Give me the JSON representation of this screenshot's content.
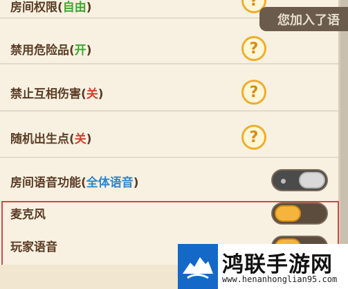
{
  "settings": {
    "room_permission": {
      "label": "房间权限",
      "value": "自由"
    },
    "ban_hazardous": {
      "label": "禁用危险品",
      "value": "开"
    },
    "no_mutual_damage": {
      "label": "禁止互相伤害",
      "value": "关"
    },
    "random_spawn": {
      "label": "随机出生点",
      "value": "关"
    },
    "room_voice": {
      "label": "房间语音功能",
      "value": "全体语音",
      "toggle": "off"
    },
    "microphone": {
      "label": "麦克风",
      "toggle": "on"
    },
    "player_voice": {
      "label": "玩家语音",
      "toggle": "on"
    }
  },
  "help_glyph": "?",
  "toast": {
    "text": "您加入了语"
  },
  "watermark": {
    "name": "鸿联手游网",
    "url": "www.henanhonglian95.com"
  },
  "colors": {
    "background": "#f8f1e2",
    "text": "#5a3b24",
    "on": "#3aa82c",
    "off": "#d2402a",
    "voice_value": "#2f86c8",
    "highlight_border": "#c94b47",
    "watermark_blue": "#1468c8"
  }
}
